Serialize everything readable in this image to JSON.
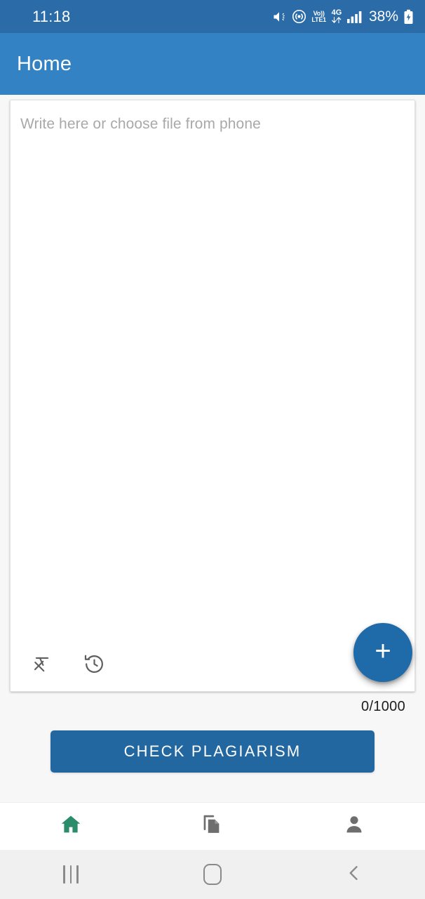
{
  "status_bar": {
    "time": "11:18",
    "battery_percent": "38%",
    "volte_label_top": "Vo))",
    "volte_label_bottom": "LTE1",
    "network_type": "4G",
    "icons": [
      "mute-icon",
      "hotspot-icon",
      "volte-icon",
      "network-4g-icon",
      "signal-bars-icon",
      "battery-charging-icon"
    ],
    "background_color": "#2b6ca8"
  },
  "app_bar": {
    "title": "Home",
    "background_color": "#3282c4"
  },
  "editor": {
    "placeholder": "Write here or choose file from phone",
    "value": "",
    "char_counter": "0/1000",
    "toolbar_icons": [
      "format-clear-icon",
      "history-icon"
    ],
    "fab_label": "+",
    "fab_color": "#1f6aa8"
  },
  "action": {
    "check_plagiarism_label": "CHECK PLAGIARISM",
    "button_color": "#22679f"
  },
  "bottom_nav": {
    "items": [
      {
        "name": "home",
        "icon": "home-icon",
        "active": true,
        "color": "#2a8c6a"
      },
      {
        "name": "documents",
        "icon": "documents-copy-icon",
        "active": false,
        "color": "#6e6e6e"
      },
      {
        "name": "profile",
        "icon": "person-icon",
        "active": false,
        "color": "#6e6e6e"
      }
    ]
  },
  "system_nav": {
    "items": [
      "recents-icon",
      "home-icon",
      "back-icon"
    ]
  }
}
